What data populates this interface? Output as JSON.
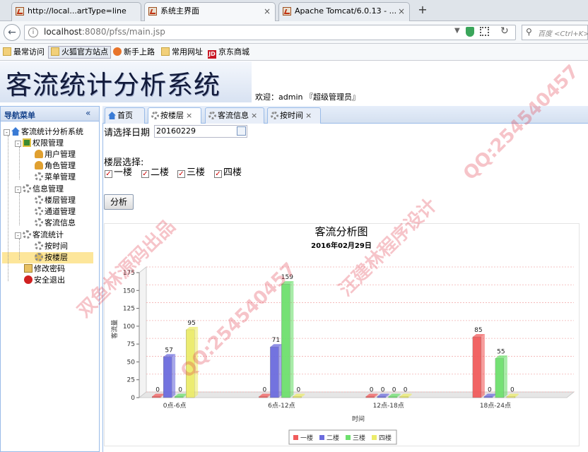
{
  "browser": {
    "tabs": [
      {
        "title": "http://local...artType=line",
        "active": false
      },
      {
        "title": "系统主界面",
        "active": true
      },
      {
        "title": "Apache Tomcat/6.0.13 - ...",
        "active": false
      }
    ],
    "new_tab_label": "+",
    "close_glyph": "×",
    "url_host": "localhost",
    "url_rest": ":8080/pfss/main.jsp",
    "search_placeholder": "百度 <Ctrl+K>",
    "bookmarks": [
      {
        "label": "最常访问",
        "icon": "folder-icon"
      },
      {
        "label": "火狐官方站点",
        "icon": "folder-icon"
      },
      {
        "label": "新手上路",
        "icon": "firefox-icon"
      },
      {
        "label": "常用网址",
        "icon": "folder-icon"
      },
      {
        "label": "京东商城",
        "icon": "jd-icon"
      }
    ]
  },
  "app": {
    "title": "客流统计分析系统",
    "welcome": "欢迎：admin 『超级管理员』"
  },
  "sidebar": {
    "title": "导航菜单",
    "collapse_glyph": "«",
    "tree": {
      "root": "客流统计分析系统",
      "perm": "权限管理",
      "user_mgmt": "用户管理",
      "role_mgmt": "角色管理",
      "menu_mgmt": "菜单管理",
      "info": "信息管理",
      "floor_mgmt": "楼层管理",
      "channel_mgmt": "通道管理",
      "flow_info": "客流信息",
      "stats": "客流统计",
      "by_time": "按时间",
      "by_floor": "按楼层",
      "change_pwd": "修改密码",
      "logout": "安全退出"
    },
    "expanded_glyph": "-"
  },
  "content_tabs": [
    {
      "label": "首页",
      "closable": false,
      "active": false
    },
    {
      "label": "按楼层",
      "closable": true,
      "active": true
    },
    {
      "label": "客流信息",
      "closable": true,
      "active": false
    },
    {
      "label": "按时间",
      "closable": true,
      "active": false
    }
  ],
  "form": {
    "date_label": "请选择日期",
    "date_value": "20160229",
    "floor_label": "楼层选择:",
    "floors": [
      {
        "label": "一楼",
        "checked": true
      },
      {
        "label": "二楼",
        "checked": true
      },
      {
        "label": "三楼",
        "checked": true
      },
      {
        "label": "四楼",
        "checked": true
      }
    ],
    "check_glyph": "✓",
    "analyze_button": "分析"
  },
  "chart_data": {
    "type": "bar",
    "title": "客流分析图",
    "subtitle": "2016年02月29日",
    "xlabel": "时间",
    "ylabel": "客流量",
    "categories": [
      "0点-6点",
      "6点-12点",
      "12点-18点",
      "18点-24点"
    ],
    "ylim": [
      0,
      175
    ],
    "yticks": [
      0,
      25,
      50,
      75,
      100,
      125,
      150,
      175
    ],
    "grid": true,
    "legend_position": "bottom",
    "series": [
      {
        "name": "一楼",
        "values": [
          0,
          0,
          0,
          85
        ],
        "color": "#f15c5c"
      },
      {
        "name": "二楼",
        "values": [
          57,
          71,
          0,
          0
        ],
        "color": "#6c6cde"
      },
      {
        "name": "三楼",
        "values": [
          0,
          159,
          0,
          55
        ],
        "color": "#6ee06e"
      },
      {
        "name": "四楼",
        "values": [
          95,
          0,
          0,
          0
        ],
        "color": "#ecec6a"
      }
    ]
  },
  "watermark_lines": [
    "QQ:254540457",
    "汪建林程序设计",
    "双鱼林源码出品"
  ]
}
